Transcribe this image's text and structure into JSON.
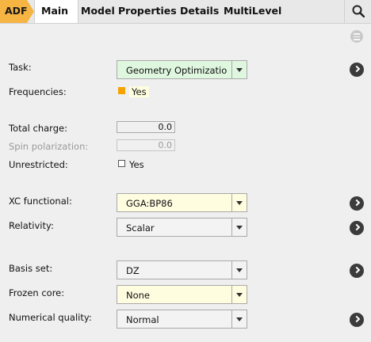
{
  "tabs": {
    "adf": "ADF",
    "main": "Main",
    "model": "Model",
    "properties": "Properties",
    "details": "Details",
    "multilevel": "MultiLevel"
  },
  "colors": {
    "adf_tab": "#f6b443",
    "task_combo_bg": "#dff6df",
    "highlight_bg": "#fffde0",
    "checked_box": "#f5a300"
  },
  "form": {
    "task": {
      "label": "Task:",
      "value": "Geometry Optimizatio"
    },
    "frequencies": {
      "label": "Frequencies:",
      "checkbox_label": "Yes",
      "checked": true
    },
    "total_charge": {
      "label": "Total charge:",
      "value": "0.0"
    },
    "spin_polarization": {
      "label": "Spin polarization:",
      "value": "0.0",
      "disabled": true
    },
    "unrestricted": {
      "label": "Unrestricted:",
      "checkbox_label": "Yes",
      "checked": false
    },
    "xc_functional": {
      "label": "XC functional:",
      "value": "GGA:BP86"
    },
    "relativity": {
      "label": "Relativity:",
      "value": "Scalar"
    },
    "basis_set": {
      "label": "Basis set:",
      "value": "DZ"
    },
    "frozen_core": {
      "label": "Frozen core:",
      "value": "None"
    },
    "numerical_quality": {
      "label": "Numerical quality:",
      "value": "Normal"
    }
  }
}
